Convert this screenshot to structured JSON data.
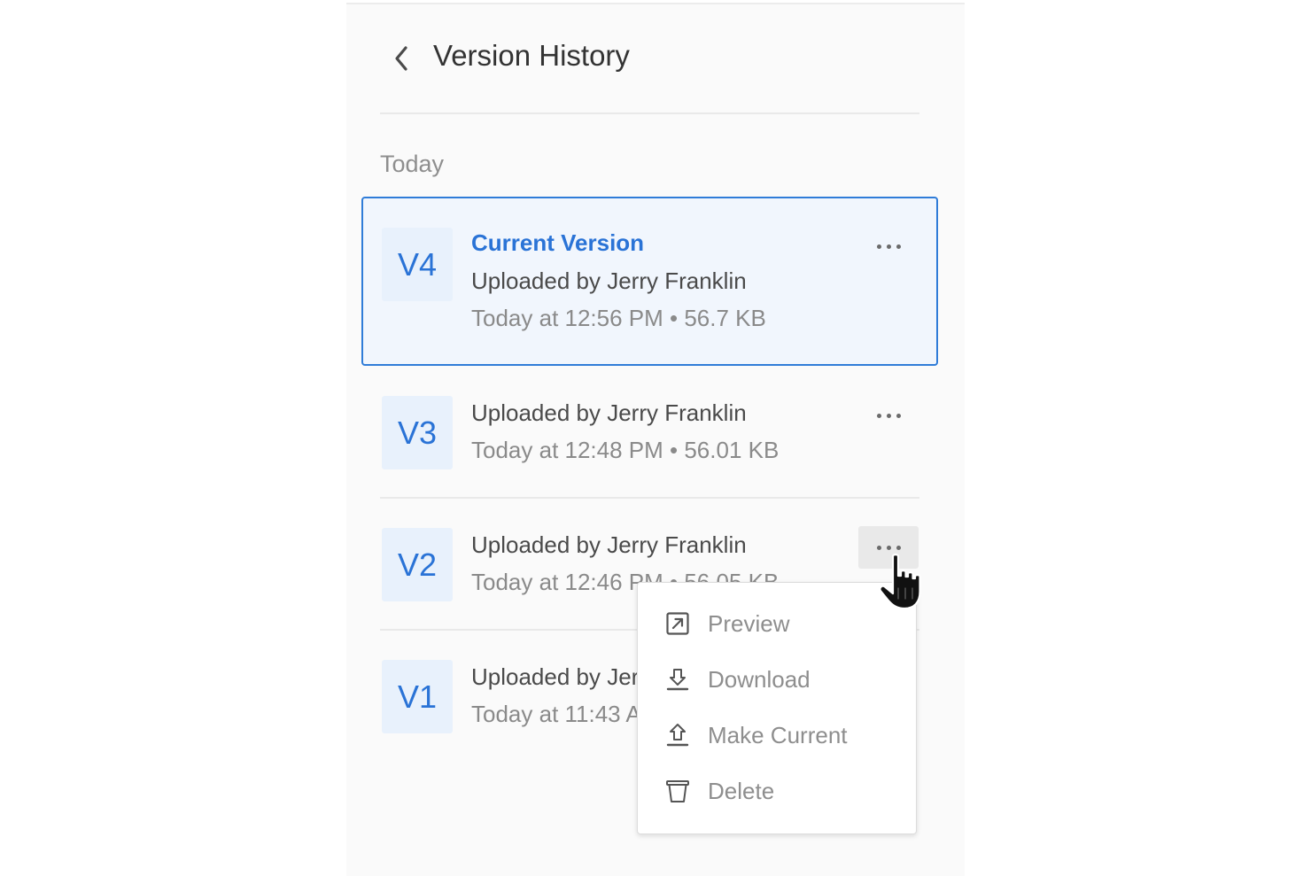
{
  "header": {
    "title": "Version History",
    "back_icon": "chevron-left-icon"
  },
  "section": {
    "label": "Today"
  },
  "versions": [
    {
      "badge": "V4",
      "status": "Current Version",
      "uploader": "Uploaded by Jerry Franklin",
      "meta": "Today at 12:56 PM • 56.7 KB",
      "selected": true
    },
    {
      "badge": "V3",
      "uploader": "Uploaded by Jerry Franklin",
      "meta": "Today at 12:48 PM • 56.01 KB"
    },
    {
      "badge": "V2",
      "uploader": "Uploaded by Jerry Franklin",
      "meta": "Today at 12:46 PM • 56.05 KB",
      "menu_open": true
    },
    {
      "badge": "V1",
      "uploader": "Uploaded by Jerry Franklin",
      "meta": "Today at 11:43 AM • 55.9 KB"
    }
  ],
  "context_menu": {
    "items": [
      {
        "label": "Preview",
        "icon": "external-link-icon"
      },
      {
        "label": "Download",
        "icon": "download-icon"
      },
      {
        "label": "Make Current",
        "icon": "upload-icon"
      },
      {
        "label": "Delete",
        "icon": "trash-icon"
      }
    ]
  },
  "colors": {
    "accent": "#2a73d6",
    "selected_border": "#2f7cd8",
    "selected_bg": "#f1f6fd",
    "badge_bg": "#e8f1fc"
  }
}
